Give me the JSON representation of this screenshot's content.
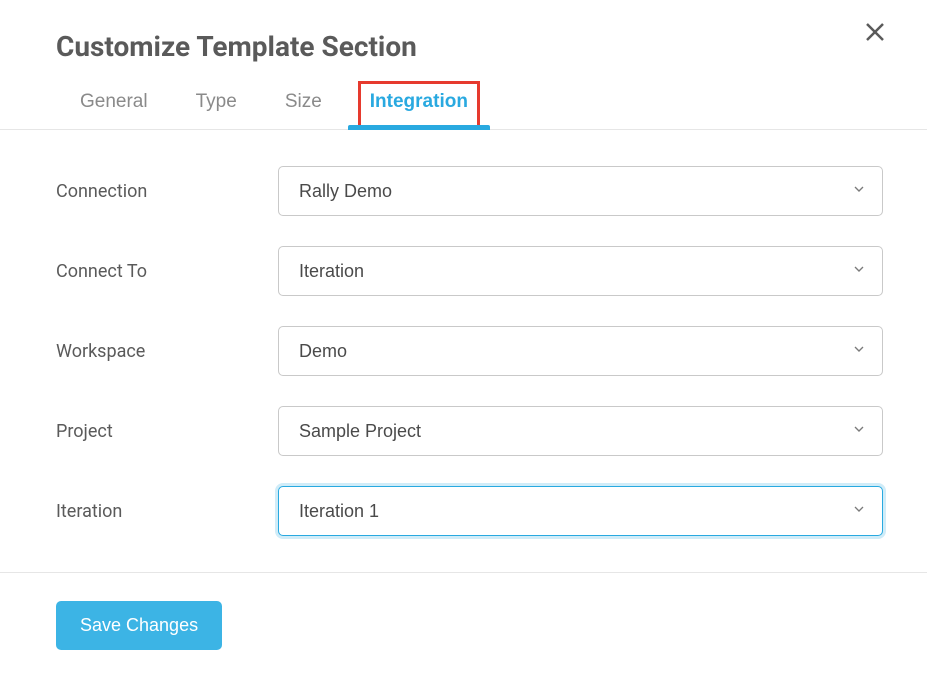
{
  "title": "Customize Template Section",
  "tabs": {
    "general": "General",
    "type": "Type",
    "size": "Size",
    "integration": "Integration"
  },
  "form": {
    "connection": {
      "label": "Connection",
      "value": "Rally Demo"
    },
    "connect_to": {
      "label": "Connect To",
      "value": "Iteration"
    },
    "workspace": {
      "label": "Workspace",
      "value": "Demo"
    },
    "project": {
      "label": "Project",
      "value": "Sample Project"
    },
    "iteration": {
      "label": "Iteration",
      "value": "Iteration 1"
    }
  },
  "footer": {
    "save_label": "Save Changes"
  }
}
